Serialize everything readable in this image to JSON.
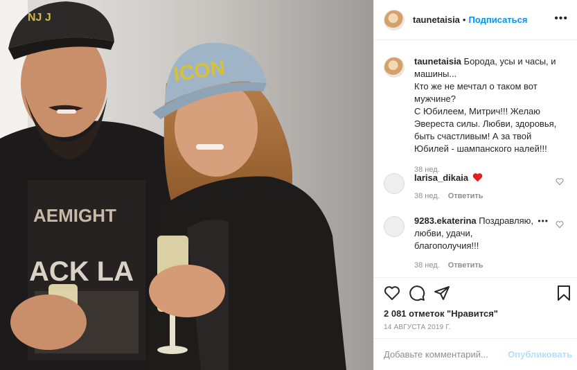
{
  "photo": {
    "cap_text": "ICON"
  },
  "header": {
    "username": "taunetaisia",
    "separator": "•",
    "follow_label": "Подписаться"
  },
  "caption": {
    "username": "taunetaisia",
    "text": "Борода, усы и часы, и машины...\nКто же не мечтал о таком вот мужчине?\nС Юбилеем, Митрич!!! Желаю Эвереста силы. Любви, здоровья, быть счастливым! А за твой Юбилей - шампанского налей!!!",
    "time": "38 нед."
  },
  "comments": [
    {
      "username": "larisa_dikaia",
      "text": "",
      "time": "38 нед.",
      "reply": "Ответить",
      "emoji": "red-heart"
    },
    {
      "username": "9283.ekaterina",
      "text": "Поздравляю, любви, удачи, благополучия!!!",
      "time": "38 нед.",
      "reply": "Ответить",
      "emoji": ""
    }
  ],
  "stats": {
    "likes": "2 081 отметок \"Нравится\"",
    "date": "14 АВГУСТА 2019 Г."
  },
  "add_comment": {
    "placeholder": "Добавьте комментарий...",
    "publish": "Опубликовать"
  },
  "colors": {
    "link_blue": "#0095f6",
    "publish_disabled": "#b2dffc",
    "heart_red": "#ed4956",
    "muted": "#8e8e8e"
  },
  "icons": [
    "more-icon",
    "heart-icon",
    "comment-icon",
    "share-icon",
    "bookmark-icon"
  ]
}
